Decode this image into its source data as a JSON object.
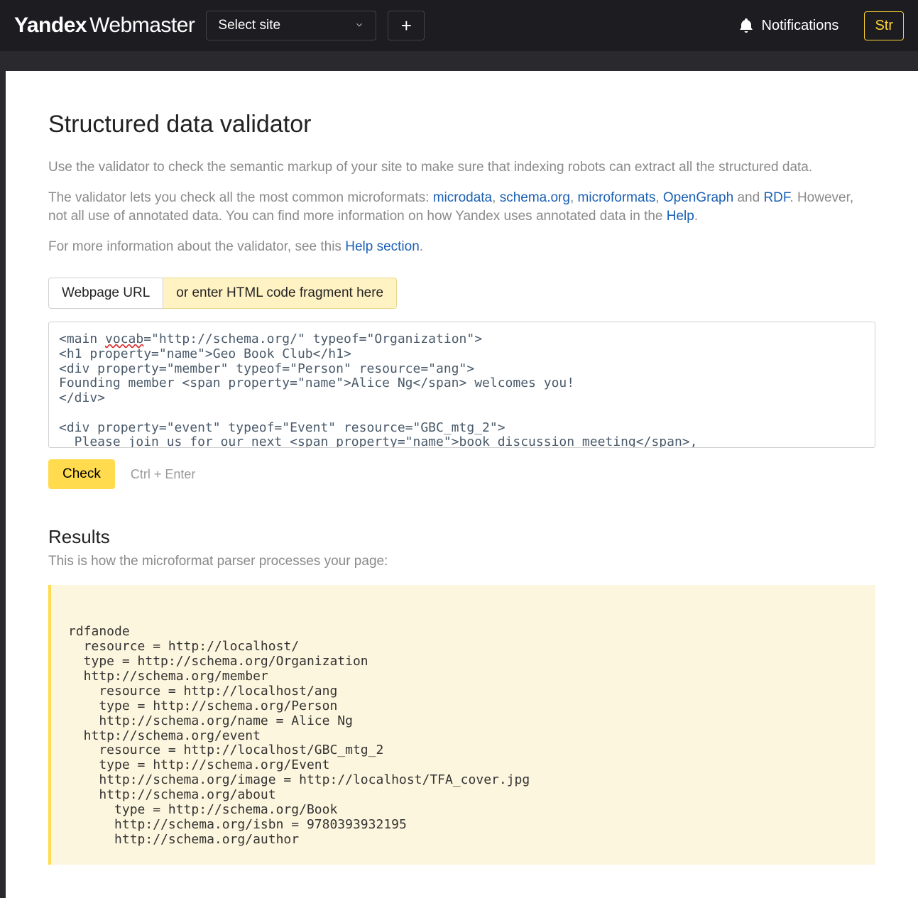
{
  "header": {
    "brand_bold": "Yandex",
    "brand_thin": "Webmaster",
    "site_select_label": "Select site",
    "notifications_label": "Notifications",
    "cta_label": "Str"
  },
  "page": {
    "title": "Structured data validator",
    "intro_p1": "Use the validator to check the semantic markup of your site to make sure that indexing robots can extract all the structured data.",
    "intro_p2_a": "The validator lets you check all the most common microformats: ",
    "intro_p2_links": {
      "microdata": "microdata",
      "schema": "schema.org",
      "microformats": "microformats",
      "opengraph": "OpenGraph",
      "rdf": "RDF"
    },
    "intro_p2_b": " and ",
    "intro_p2_c": ". However, not all use of annotated data. You can find more information on how Yandex uses annotated data in the ",
    "intro_p2_help": "Help",
    "intro_p3_a": "For more information about the validator, see this ",
    "intro_p3_link": "Help section",
    "tabs": {
      "url": "Webpage URL",
      "html": "or enter HTML code fragment here"
    },
    "code_input": "<main vocab=\"http://schema.org/\" typeof=\"Organization\">\n<h1 property=\"name\">Geo Book Club</h1>\n<div property=\"member\" typeof=\"Person\" resource=\"ang\">\nFounding member <span property=\"name\">Alice Ng</span> welcomes you!\n</div>\n\n<div property=\"event\" typeof=\"Event\" resource=\"GBC_mtg_2\">\n  Please join us for our next <span property=\"name\">book discussion meeting</span>,\n  all about the novel",
    "check_label": "Check",
    "shortcut": "Ctrl + Enter",
    "results_title": "Results",
    "results_sub": "This is how the microformat parser processes your page:",
    "results_output": "rdfanode\n  resource = http://localhost/\n  type = http://schema.org/Organization\n  http://schema.org/member\n    resource = http://localhost/ang\n    type = http://schema.org/Person\n    http://schema.org/name = Alice Ng\n  http://schema.org/event\n    resource = http://localhost/GBC_mtg_2\n    type = http://schema.org/Event\n    http://schema.org/image = http://localhost/TFA_cover.jpg\n    http://schema.org/about\n      type = http://schema.org/Book\n      http://schema.org/isbn = 9780393932195\n      http://schema.org/author"
  }
}
